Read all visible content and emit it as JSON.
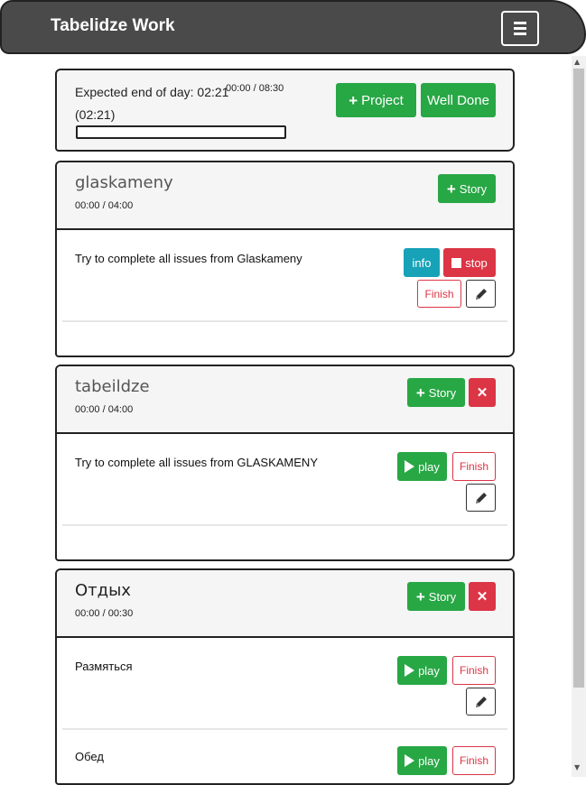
{
  "navbar": {
    "brand": "Tabelidze Work",
    "menu_icon": "hamburger-icon"
  },
  "summary": {
    "expected_label": "Expected end of day: 02:21",
    "time": "00:00 / 08:30",
    "sub": "(02:21)",
    "progress": 0,
    "project_button": "Project",
    "well_done_button": "Well Done"
  },
  "projects": [
    {
      "title": "glaskameny",
      "time": "00:00 / 04:00",
      "story_button": "Story",
      "stories": [
        {
          "text": "Try to complete all issues from Glaskameny",
          "info": "info",
          "stop": "stop",
          "finish": "Finish"
        }
      ]
    },
    {
      "title": "tabeildze",
      "time": "00:00 / 04:00",
      "story_button": "Story",
      "stories": [
        {
          "text": "Try to complete all issues from GLASKAMENY",
          "play": "play",
          "finish": "Finish"
        }
      ]
    },
    {
      "title": "Отдых",
      "time": "00:00 / 00:30",
      "story_button": "Story",
      "stories": [
        {
          "text": "Размяться",
          "play": "play",
          "finish": "Finish"
        },
        {
          "text": "Обед",
          "play": "play",
          "finish": "Finish"
        }
      ]
    }
  ],
  "colors": {
    "green": "#28a745",
    "red": "#dc3545",
    "info": "#17a2b8",
    "navbar": "#4a4a4a"
  }
}
